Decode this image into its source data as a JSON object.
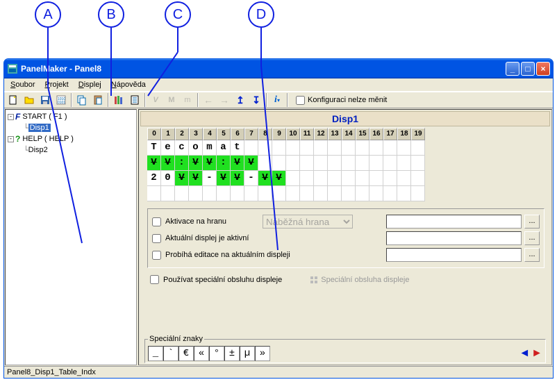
{
  "callouts": {
    "a": "A",
    "b": "B",
    "c": "C",
    "d": "D"
  },
  "window": {
    "title": "PanelMaker - Panel8"
  },
  "menu": {
    "file": "Soubor",
    "project": "Projekt",
    "display": "Displej",
    "help": "Nápověda"
  },
  "toolbar": {
    "config_lock_label": "Konfiguraci nelze měnit"
  },
  "tree": {
    "nodes": [
      {
        "label": "START ( F1 )",
        "icon": "F"
      },
      {
        "label": "Disp1",
        "selected": true
      },
      {
        "label": "HELP ( HELP )",
        "icon": "?"
      },
      {
        "label": "Disp2"
      }
    ]
  },
  "display": {
    "title": "Disp1",
    "columns": [
      "0",
      "1",
      "2",
      "3",
      "4",
      "5",
      "6",
      "7",
      "8",
      "9",
      "10",
      "11",
      "12",
      "13",
      "14",
      "15",
      "16",
      "17",
      "18",
      "19"
    ],
    "rows": [
      [
        {
          "c": "T"
        },
        {
          "c": "e"
        },
        {
          "c": "c"
        },
        {
          "c": "o"
        },
        {
          "c": "m"
        },
        {
          "c": "a"
        },
        {
          "c": "t"
        },
        {
          "c": ""
        },
        {
          "c": ""
        },
        {
          "c": ""
        },
        {
          "c": ""
        },
        {
          "c": ""
        },
        {
          "c": ""
        },
        {
          "c": ""
        },
        {
          "c": ""
        },
        {
          "c": ""
        },
        {
          "c": ""
        },
        {
          "c": ""
        },
        {
          "c": ""
        },
        {
          "c": ""
        }
      ],
      [
        {
          "c": "V",
          "g": 1,
          "s": 1
        },
        {
          "c": "V",
          "g": 1,
          "s": 1
        },
        {
          "c": ":",
          "g": 1
        },
        {
          "c": "V",
          "g": 1,
          "s": 1
        },
        {
          "c": "V",
          "g": 1,
          "s": 1
        },
        {
          "c": ":",
          "g": 1
        },
        {
          "c": "V",
          "g": 1,
          "s": 1
        },
        {
          "c": "V",
          "g": 1,
          "s": 1
        },
        {
          "c": ""
        },
        {
          "c": ""
        },
        {
          "c": ""
        },
        {
          "c": ""
        },
        {
          "c": ""
        },
        {
          "c": ""
        },
        {
          "c": ""
        },
        {
          "c": ""
        },
        {
          "c": ""
        },
        {
          "c": ""
        },
        {
          "c": ""
        },
        {
          "c": ""
        }
      ],
      [
        {
          "c": "2"
        },
        {
          "c": "0"
        },
        {
          "c": "V",
          "g": 1,
          "s": 1
        },
        {
          "c": "V",
          "g": 1,
          "s": 1
        },
        {
          "c": "-"
        },
        {
          "c": "V",
          "g": 1,
          "s": 1
        },
        {
          "c": "V",
          "g": 1,
          "s": 1
        },
        {
          "c": "-"
        },
        {
          "c": "V",
          "g": 1,
          "s": 1
        },
        {
          "c": "V",
          "g": 1,
          "s": 1
        },
        {
          "c": ""
        },
        {
          "c": ""
        },
        {
          "c": ""
        },
        {
          "c": ""
        },
        {
          "c": ""
        },
        {
          "c": ""
        },
        {
          "c": ""
        },
        {
          "c": ""
        },
        {
          "c": ""
        },
        {
          "c": ""
        }
      ],
      [
        {
          "c": ""
        },
        {
          "c": ""
        },
        {
          "c": ""
        },
        {
          "c": ""
        },
        {
          "c": ""
        },
        {
          "c": ""
        },
        {
          "c": ""
        },
        {
          "c": ""
        },
        {
          "c": ""
        },
        {
          "c": ""
        },
        {
          "c": ""
        },
        {
          "c": ""
        },
        {
          "c": ""
        },
        {
          "c": ""
        },
        {
          "c": ""
        },
        {
          "c": ""
        },
        {
          "c": ""
        },
        {
          "c": ""
        },
        {
          "c": ""
        },
        {
          "c": ""
        }
      ]
    ]
  },
  "options": {
    "edge_activate": "Aktivace na hranu",
    "edge_dropdown": "Náběžná hrana",
    "active_display": "Aktuální displej je aktivní",
    "editing": "Probíhá editace na aktuálním displeji",
    "special_handler": "Používat speciální obsluhu displeje",
    "special_handler_btn": "Speciální obsluha displeje",
    "dots": "..."
  },
  "special": {
    "legend": "Speciální znaky",
    "chars": [
      "_",
      "`",
      "€",
      "«",
      "°",
      "±",
      "µ",
      "»"
    ]
  },
  "status": "Panel8_Disp1_Table_Indx"
}
